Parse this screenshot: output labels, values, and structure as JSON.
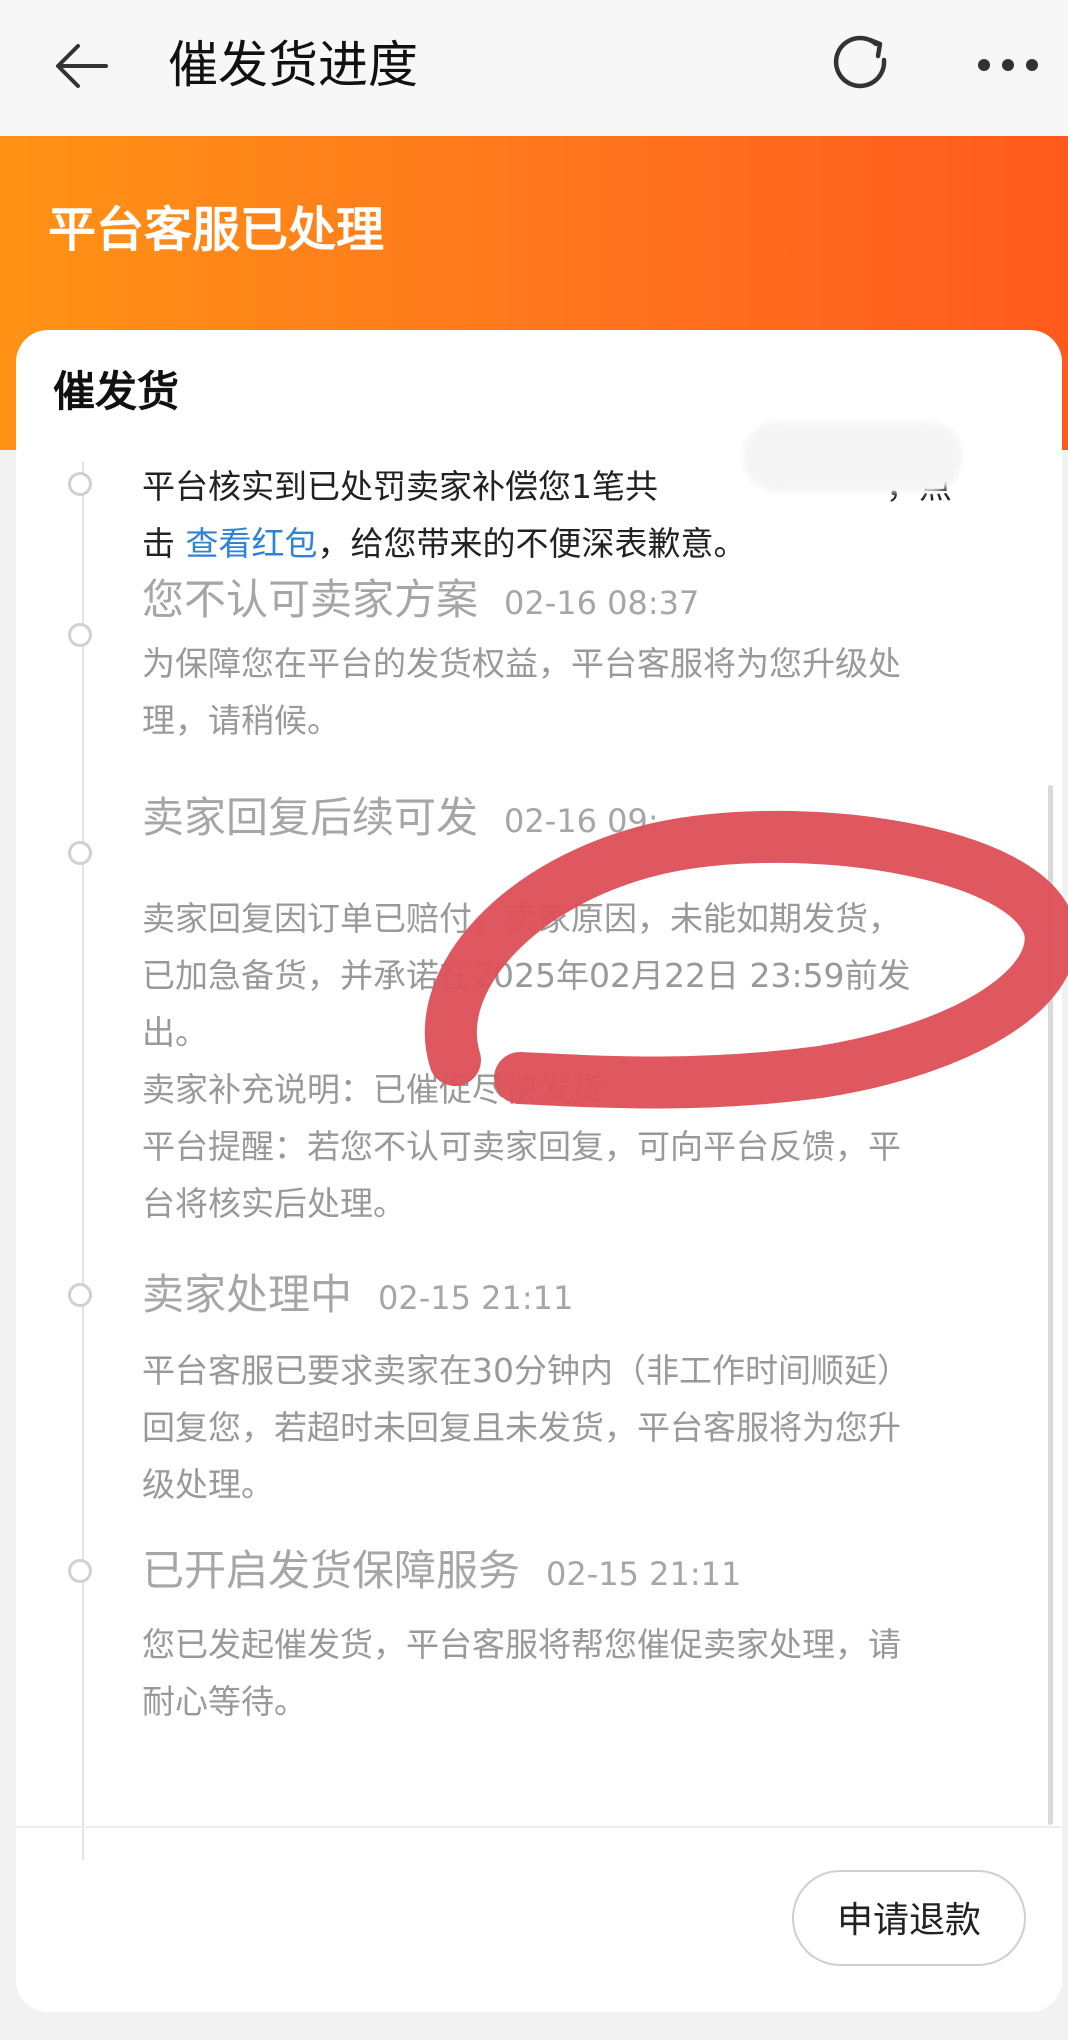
{
  "header": {
    "title": "催发货进度"
  },
  "icons": {
    "back": "back-arrow-icon",
    "refresh": "refresh-icon",
    "more": "more-dots-icon"
  },
  "banner": {
    "status": "平台客服已处理"
  },
  "card": {
    "title": "催发货",
    "top_entry": {
      "text_before": "平台核实到已处罚卖家补偿您1笔共",
      "text_after_redaction": "，点",
      "text_line2_start": "击 ",
      "link_label": "查看红包",
      "text_line2_end": "，给您带来的不便深表歉意。"
    },
    "steps": [
      {
        "title": "您不认可卖家方案",
        "time": "02-16 08:37",
        "lines": [
          "为保障您在平台的发货权益，平台客服将为您升级处",
          "理，请稍候。"
        ]
      },
      {
        "title": "卖家回复后续可发",
        "time": "02-16 09:",
        "lines": [
          "卖家回复因订单已赔付，卖家原因，未能如期发货，",
          "已加急备货，并承诺在2025年02月22日 23:59前发",
          "出。",
          "卖家补充说明：已催促尽快发货",
          "平台提醒：若您不认可卖家回复，可向平台反馈，平",
          "台将核实后处理。"
        ]
      },
      {
        "title": "卖家处理中",
        "time": "02-15 21:11",
        "lines": [
          "平台客服已要求卖家在30分钟内（非工作时间顺延）",
          "回复您，若超时未回复且未发货，平台客服将为您升",
          "级处理。"
        ]
      },
      {
        "title": "已开启发货保障服务",
        "time": "02-15 21:11",
        "lines": [
          "您已发起催发货，平台客服将帮您催促卖家处理，请",
          "耐心等待。"
        ]
      }
    ]
  },
  "footer": {
    "refund_button": "申请退款"
  },
  "colors": {
    "banner_start": "#ff9214",
    "banner_end": "#ff5a1e",
    "link": "#2f83d7",
    "annotation_stroke": "#de5058"
  }
}
